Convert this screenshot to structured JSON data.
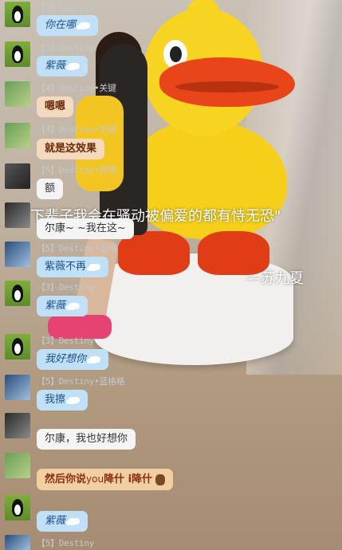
{
  "overlay": {
    "quote": "下辈子我会在骚动被偏爱的都有恃无恐\"",
    "author": "—苏九夏"
  },
  "messages": [
    {
      "sender": "【3】Destiny",
      "text": "你在哪",
      "avatar": "penguin-avatar",
      "style": "blue"
    },
    {
      "sender": "【3】Destiny",
      "text": "紫薇",
      "avatar": "penguin-avatar",
      "style": "blue"
    },
    {
      "sender": "【4】Destiny•关键",
      "text": "嗯嗯",
      "avatar": "green-avatar",
      "style": "brown"
    },
    {
      "sender": "【4】Destiny•关键",
      "text": "就是这效果",
      "avatar": "green-avatar",
      "style": "brown"
    },
    {
      "sender": "【5】Destiny•柯南",
      "text": "额",
      "avatar": "dark-avatar",
      "style": "white"
    },
    {
      "sender": "",
      "text": "尔康~ ~我在这~",
      "avatar": "grey-avatar",
      "style": "white"
    },
    {
      "sender": "【5】Destiny•蓝格",
      "text": "紫薇不再",
      "avatar": "blue-avatar",
      "style": "blue"
    },
    {
      "sender": "【3】Destiny",
      "text": "紫薇",
      "avatar": "penguin-avatar",
      "style": "blue"
    },
    {
      "sender": "【3】Destiny",
      "text": "我好想你",
      "avatar": "penguin-avatar",
      "style": "blue"
    },
    {
      "sender": "【5】Destiny•蓝格格",
      "text": "我擦",
      "avatar": "blue-avatar",
      "style": "blue"
    },
    {
      "sender": "",
      "text": "尔康，我也好想你",
      "avatar": "grey-avatar",
      "style": "white"
    },
    {
      "sender": "",
      "text_a": "然后你说",
      "text_b": "you",
      "text_c": "降什 i降什",
      "avatar": "green-avatar",
      "style": "tan"
    },
    {
      "sender": "",
      "text": "紫薇",
      "avatar": "penguin-avatar",
      "style": "blue"
    },
    {
      "sender": "【5】Destiny",
      "text": "",
      "avatar": "blue-avatar",
      "style": "none"
    }
  ]
}
